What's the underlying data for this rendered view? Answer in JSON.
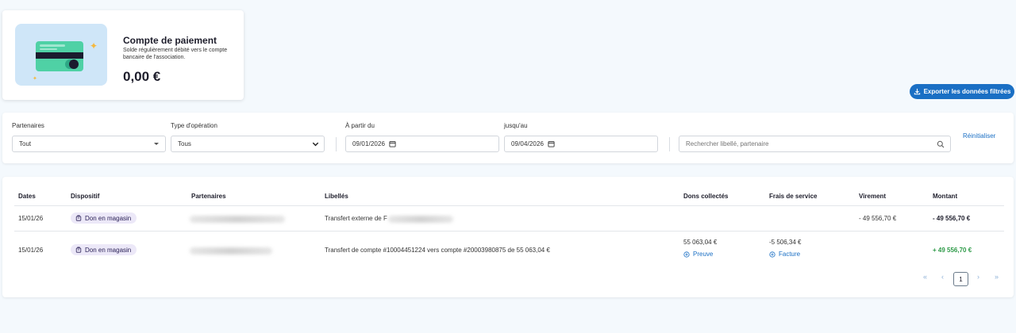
{
  "account": {
    "title": "Compte de paiement",
    "description": "Solde régulièrement débité vers le compte bancaire de l'association.",
    "balance": "0,00 €"
  },
  "toolbar": {
    "export_label": "Exporter les données filtrées"
  },
  "filters": {
    "partners_label": "Partenaires",
    "partners_value": "Tout",
    "type_label": "Type d'opération",
    "type_value": "Tous",
    "from_label": "À partir du",
    "from_value": "09/01/2026",
    "to_label": "jusqu'au",
    "to_value": "09/04/2026",
    "search_placeholder": "Rechercher libellé, partenaire",
    "reset_label": "Réinitialiser"
  },
  "table": {
    "columns": [
      "Dates",
      "Dispositif",
      "Partenaires",
      "Libellés",
      "Dons collectés",
      "Frais de service",
      "Virement",
      "Montant"
    ],
    "rows": [
      {
        "date": "15/01/26",
        "device": "Don en magasin",
        "label": "Transfert externe de F",
        "donations": "",
        "fees": "",
        "transfer": "- 49 556,70 €",
        "amount": "- 49 556,70 €"
      },
      {
        "date": "15/01/26",
        "device": "Don en magasin",
        "label": "Transfert de compte #10004451224 vers compte #20003980875 de 55 063,04 €",
        "donations": "55 063,04 €",
        "donations_link": "Preuve",
        "fees": "-5 506,34 €",
        "fees_link": "Facture",
        "transfer": "",
        "amount": "+ 49 556,70 €"
      }
    ]
  },
  "pagination": {
    "first": "«",
    "prev": "‹",
    "current": "1",
    "next": "›",
    "last": "»"
  },
  "colors": {
    "accent": "#1a6fc4",
    "positive": "#2e9a48",
    "badge_bg": "#ece8f8"
  }
}
